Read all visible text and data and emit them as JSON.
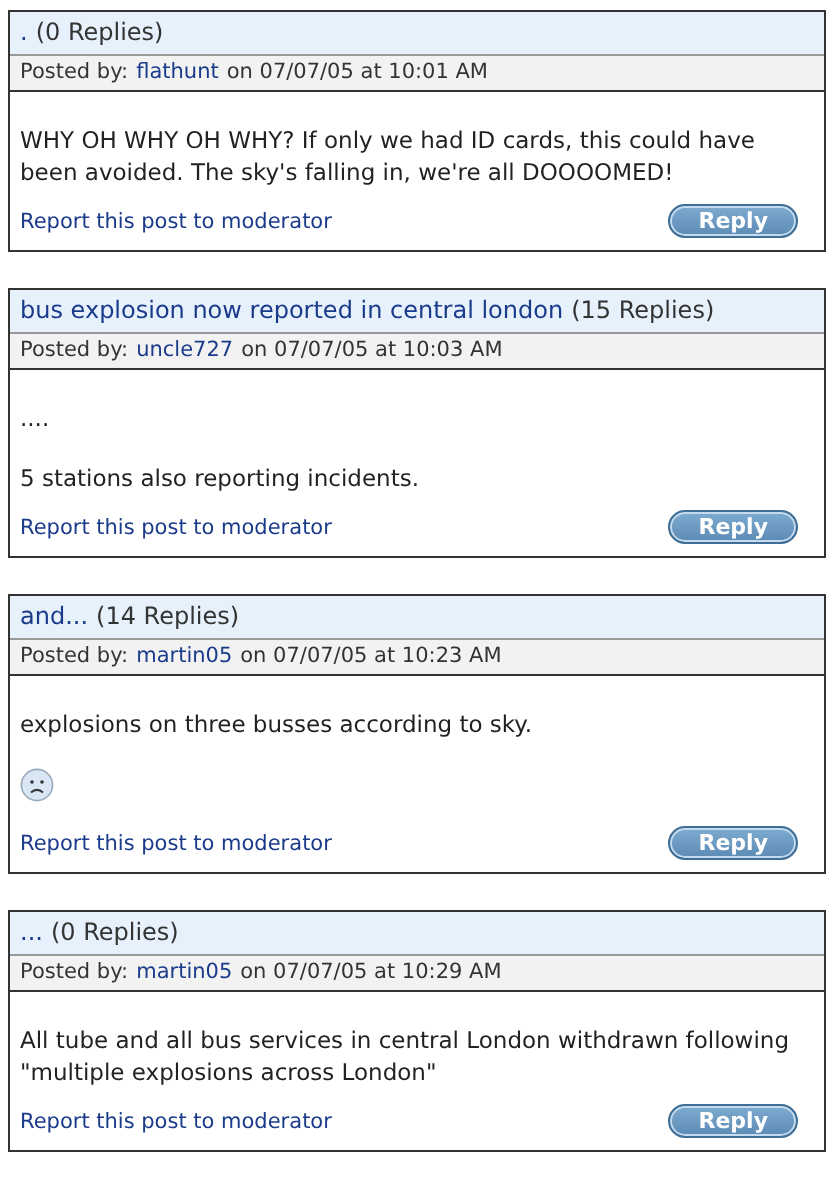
{
  "posts": [
    {
      "title": ".",
      "replies": "(0 Replies)",
      "posted_label": "Posted by:",
      "author": "flathunt",
      "when": "on 07/07/05 at 10:01 AM",
      "body": [
        {
          "kind": "text",
          "text": "WHY OH WHY OH WHY? If only we had ID cards, this could have been avoided. The sky's falling in, we're all DOOOOMED!"
        }
      ],
      "report": "Report this post to moderator",
      "reply": "Reply"
    },
    {
      "title": "bus explosion now reported in central london",
      "replies": "(15 Replies)",
      "posted_label": "Posted by:",
      "author": "uncle727",
      "when": "on 07/07/05 at 10:03 AM",
      "body": [
        {
          "kind": "text",
          "text": "...."
        },
        {
          "kind": "text",
          "text": "5 stations also reporting incidents."
        }
      ],
      "report": "Report this post to moderator",
      "reply": "Reply"
    },
    {
      "title": "and...",
      "replies": "(14 Replies)",
      "posted_label": "Posted by:",
      "author": "martin05",
      "when": "on 07/07/05 at 10:23 AM",
      "body": [
        {
          "kind": "text",
          "text": "explosions on three busses according to sky."
        },
        {
          "kind": "smiley"
        }
      ],
      "report": "Report this post to moderator",
      "reply": "Reply"
    },
    {
      "title": "...",
      "replies": "(0 Replies)",
      "posted_label": "Posted by:",
      "author": "martin05",
      "when": "on 07/07/05 at 10:29 AM",
      "body": [
        {
          "kind": "text",
          "text": "All tube and all bus services in central London withdrawn following \"multiple explosions across London\""
        }
      ],
      "report": "Report this post to moderator",
      "reply": "Reply"
    }
  ]
}
